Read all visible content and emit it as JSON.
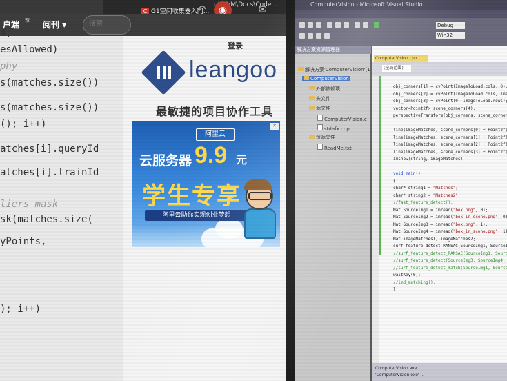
{
  "browser": {
    "tabs": [
      {
        "label": "ntLLVM\\Docs\\Code..."
      },
      {
        "label": "G1空间收集器入门...",
        "icon_text": "C"
      }
    ],
    "user_name": "户端",
    "user_badge": "荐",
    "discover_menu": "阅刊 ▾",
    "search_placeholder": "搜索"
  },
  "code_lines": [
    {
      "text": " 4;",
      "kind": "code"
    },
    {
      "text": "esAllowed)",
      "kind": "code"
    },
    {
      "text": "phy",
      "kind": "comment"
    },
    {
      "text": "s(matches.size())",
      "kind": "code"
    },
    {
      "text": "s(matches.size())",
      "kind": "code"
    },
    {
      "text": "(); i++)",
      "kind": "code"
    },
    {
      "text": "atches[i].queryId",
      "kind": "code"
    },
    {
      "text": "atches[i].trainId",
      "kind": "code"
    },
    {
      "text": "liers mask",
      "kind": "comment"
    },
    {
      "text": "sk(matches.size(",
      "kind": "code"
    },
    {
      "text": "yPoints,",
      "kind": "code"
    },
    {
      "text": "); i++)",
      "kind": "code"
    }
  ],
  "ad_panel": {
    "login": "登录",
    "logo_text": "leangoo",
    "slogan": "最敏捷的项目协作工具",
    "banner": {
      "close": "✕",
      "aliyun": "阿里云",
      "server": "云服务器",
      "price": "9.9",
      "price_unit": "元",
      "student": "学生专享",
      "tagline": "阿里云助你实现创业梦想"
    }
  },
  "vs": {
    "title": "ComputerVision - Microsoft Visual Studio",
    "debug_config": "Debug",
    "platform": "Win32",
    "solution_explorer": {
      "header": "解决方案资源管理器",
      "items": [
        {
          "label": "解决方案'ComputerVision'(1",
          "type": "solution"
        },
        {
          "label": "ComputerVision",
          "type": "project"
        },
        {
          "label": "外部依赖项",
          "type": "folder"
        },
        {
          "label": "头文件",
          "type": "folder"
        },
        {
          "label": "源文件",
          "type": "folder"
        },
        {
          "label": "ComputerVision.c",
          "type": "file"
        },
        {
          "label": "stdafx.cpp",
          "type": "file"
        },
        {
          "label": "资源文件",
          "type": "folder"
        },
        {
          "label": "ReadMe.txt",
          "type": "file"
        }
      ]
    },
    "editor_tab": "ComputerVision.cpp",
    "editor_scope": "(全局范围)",
    "editor_lines": [
      {
        "text": "obj_corners[1] = cvPoint(ImageToLoad.cols, 0);",
        "kind": "code"
      },
      {
        "text": "obj_corners[2] = cvPoint(ImageToLoad.cols, ImageTo",
        "kind": "code"
      },
      {
        "text": "obj_corners[3] = cvPoint(0, ImageToLoad.rows);",
        "kind": "code"
      },
      {
        "text": "vector<Point2f> scene_corners(4);",
        "kind": "code"
      },
      {
        "text": "perspectiveTransform(obj_corners, scene_corners, H",
        "kind": "code"
      },
      {
        "text": "",
        "kind": "code"
      },
      {
        "text": "line(imageMatches, scene_corners[0] + Point2f(Imag",
        "kind": "code"
      },
      {
        "text": "line(imageMatches, scene_corners[1] + Point2f(Imag",
        "kind": "code"
      },
      {
        "text": "line(imageMatches, scene_corners[2] + Point2f(Imag",
        "kind": "code"
      },
      {
        "text": "line(imageMatches, scene_corners[3] + Point2f(Imag",
        "kind": "code"
      },
      {
        "text": "imshow(string, imageMatches)",
        "kind": "code"
      },
      {
        "text": "",
        "kind": "code"
      },
      {
        "text": "void main()",
        "kind": "keyword"
      },
      {
        "text": "{",
        "kind": "code"
      },
      {
        "text": "  char* string1 = \"Matches\";",
        "kind": "string"
      },
      {
        "text": "  char* string2 = \"Matches2\"",
        "kind": "string"
      },
      {
        "text": "  //fast_feature_detect();",
        "kind": "comment"
      },
      {
        "text": "  Mat SourceImg1 = imread(\"box.png\", 0);",
        "kind": "string"
      },
      {
        "text": "  Mat SourceImg2 = imread(\"box_in_scene.png\", 0);",
        "kind": "string"
      },
      {
        "text": "  Mat SourceImg3 = imread(\"box.png\", 1);",
        "kind": "string"
      },
      {
        "text": "  Mat SourceImg4 = imread(\"box_in_scene.png\", 1);",
        "kind": "string"
      },
      {
        "text": "  Mat imageMatches1, imageMatches2;",
        "kind": "code"
      },
      {
        "text": "  surf_feature_detect_RANSAC(SourceImg1, SourceImg",
        "kind": "code"
      },
      {
        "text": "  //surf_feature_detect_RANSAC(SourceImg1, SourceImg",
        "kind": "comment"
      },
      {
        "text": "  //surf_feature_detect(SourceImg3, SourceImg4, ima",
        "kind": "comment"
      },
      {
        "text": "  //surf_feature_detect_match(SourceImg1, SourceImg",
        "kind": "comment"
      },
      {
        "text": "  waitKey(0);",
        "kind": "code"
      },
      {
        "text": "  //imd_matching();",
        "kind": "comment"
      },
      {
        "text": "}",
        "kind": "code"
      }
    ],
    "output_lines": [
      "ComputerVision.exe ...",
      "'ComputerVision.exe' ..."
    ]
  },
  "colors": {
    "logo_blue": "#2c4a86",
    "banner_blue": "#1e5fb5",
    "price_yellow": "#ffd94a",
    "vs_tab_yellow": "#f2d66a"
  }
}
